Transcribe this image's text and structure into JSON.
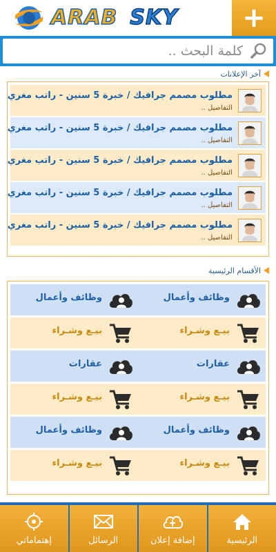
{
  "header": {
    "logo_word1": "ARAB",
    "logo_word2": "SKY",
    "plus_label": "+"
  },
  "search": {
    "placeholder": "كلمة البحث .."
  },
  "latest_ads": {
    "section_title": "آخر الإعلانات",
    "items": [
      {
        "title": "مطلوب مصمم جرافيك / خبرة 5 سنين - راتب مغري",
        "details": "التفاصيل .."
      },
      {
        "title": "مطلوب مصمم جرافيك / خبرة 5 سنين - راتب مغري",
        "details": "التفاصيل .."
      },
      {
        "title": "مطلوب مصمم جرافيك / خبرة 5 سنين - راتب مغري",
        "details": "التفاصيل .."
      },
      {
        "title": "مطلوب مصمم جرافيك / خبرة 5 سنين - راتب مغري",
        "details": "التفاصيل .."
      },
      {
        "title": "مطلوب مصمم جرافيك / خبرة 5 سنين - راتب مغري",
        "details": "التفاصيل .."
      }
    ]
  },
  "main_categories": {
    "section_title": "الأقسام الرئيسية",
    "rows": [
      {
        "style": "blue",
        "cells": [
          {
            "label": "وظائف وأعمال",
            "icon": "cloud-user-icon",
            "color": "blue"
          },
          {
            "label": "وظائف وأعمال",
            "icon": "cloud-user-icon",
            "color": "blue"
          }
        ]
      },
      {
        "style": "beige",
        "cells": [
          {
            "label": "بيـع وشـراء",
            "icon": "cart-icon",
            "color": "gold"
          },
          {
            "label": "بيـع وشـراء",
            "icon": "cart-icon",
            "color": "gold"
          }
        ]
      },
      {
        "style": "blue",
        "cells": [
          {
            "label": "عقارات",
            "icon": "cloud-user-icon",
            "color": "blue"
          },
          {
            "label": "عقارات",
            "icon": "cloud-user-icon",
            "color": "blue"
          }
        ]
      },
      {
        "style": "beige",
        "cells": [
          {
            "label": "بيـع وشـراء",
            "icon": "cart-icon",
            "color": "gold"
          },
          {
            "label": "بيـع وشـراء",
            "icon": "cart-icon",
            "color": "gold"
          }
        ]
      },
      {
        "style": "blue",
        "cells": [
          {
            "label": "وظائف وأعمال",
            "icon": "cloud-user-icon",
            "color": "blue"
          },
          {
            "label": "وظائف وأعمال",
            "icon": "cloud-user-icon",
            "color": "blue"
          }
        ]
      },
      {
        "style": "beige",
        "cells": [
          {
            "label": "بيـع وشـراء",
            "icon": "cart-icon",
            "color": "gold"
          },
          {
            "label": "بيـع وشـراء",
            "icon": "cart-icon",
            "color": "gold"
          }
        ]
      }
    ]
  },
  "bottom_nav": {
    "tabs": [
      {
        "label": "الرئيسية",
        "icon": "home-icon"
      },
      {
        "label": "إضافة إعلان",
        "icon": "cloud-upload-icon"
      },
      {
        "label": "الرسائل",
        "icon": "envelope-icon"
      },
      {
        "label": "إهتماماتي",
        "icon": "target-icon"
      }
    ]
  },
  "colors": {
    "accent_blue": "#1e8ed6",
    "accent_orange": "#f0a020",
    "row_blue": "#cfe0f5",
    "row_beige": "#fdebc8"
  }
}
